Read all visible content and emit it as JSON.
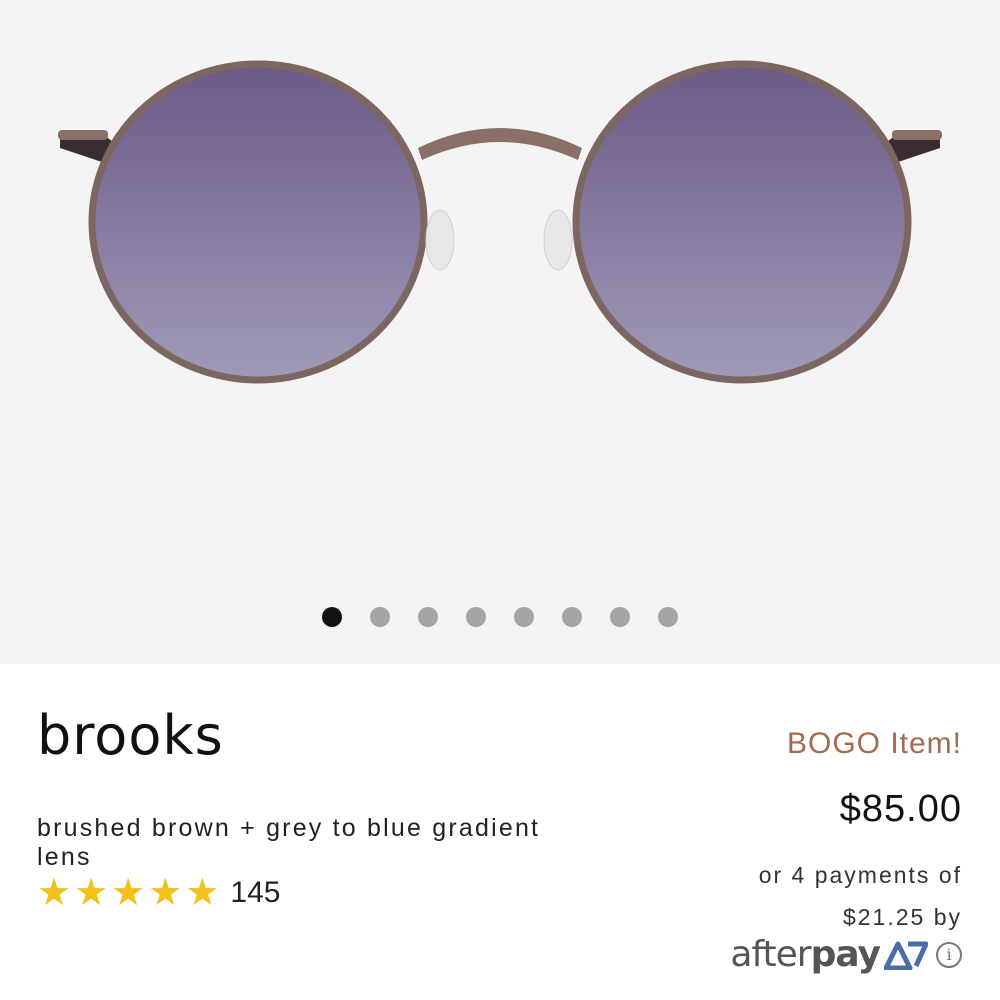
{
  "gallery": {
    "image_subject": "sunglasses-front-view",
    "dots": [
      {
        "active": true
      },
      {
        "active": false
      },
      {
        "active": false
      },
      {
        "active": false
      },
      {
        "active": false
      },
      {
        "active": false
      },
      {
        "active": false
      },
      {
        "active": false
      }
    ]
  },
  "product": {
    "name": "brooks",
    "variant": "brushed brown + grey to blue gradient lens",
    "rating_stars": 5,
    "review_count": "145",
    "badge": "BOGO Item!",
    "price": "$85.00",
    "installments_line1": "or 4 payments of",
    "installments_line2": "$21.25 by",
    "payment_provider_light": "after",
    "payment_provider_bold": "pay",
    "info_symbol": "i"
  },
  "colors": {
    "badge": "#a26a50",
    "star": "#f2c21b",
    "dot_active": "#111111",
    "dot_inactive": "#a4a4a4",
    "gallery_bg": "#f4f4f4"
  }
}
